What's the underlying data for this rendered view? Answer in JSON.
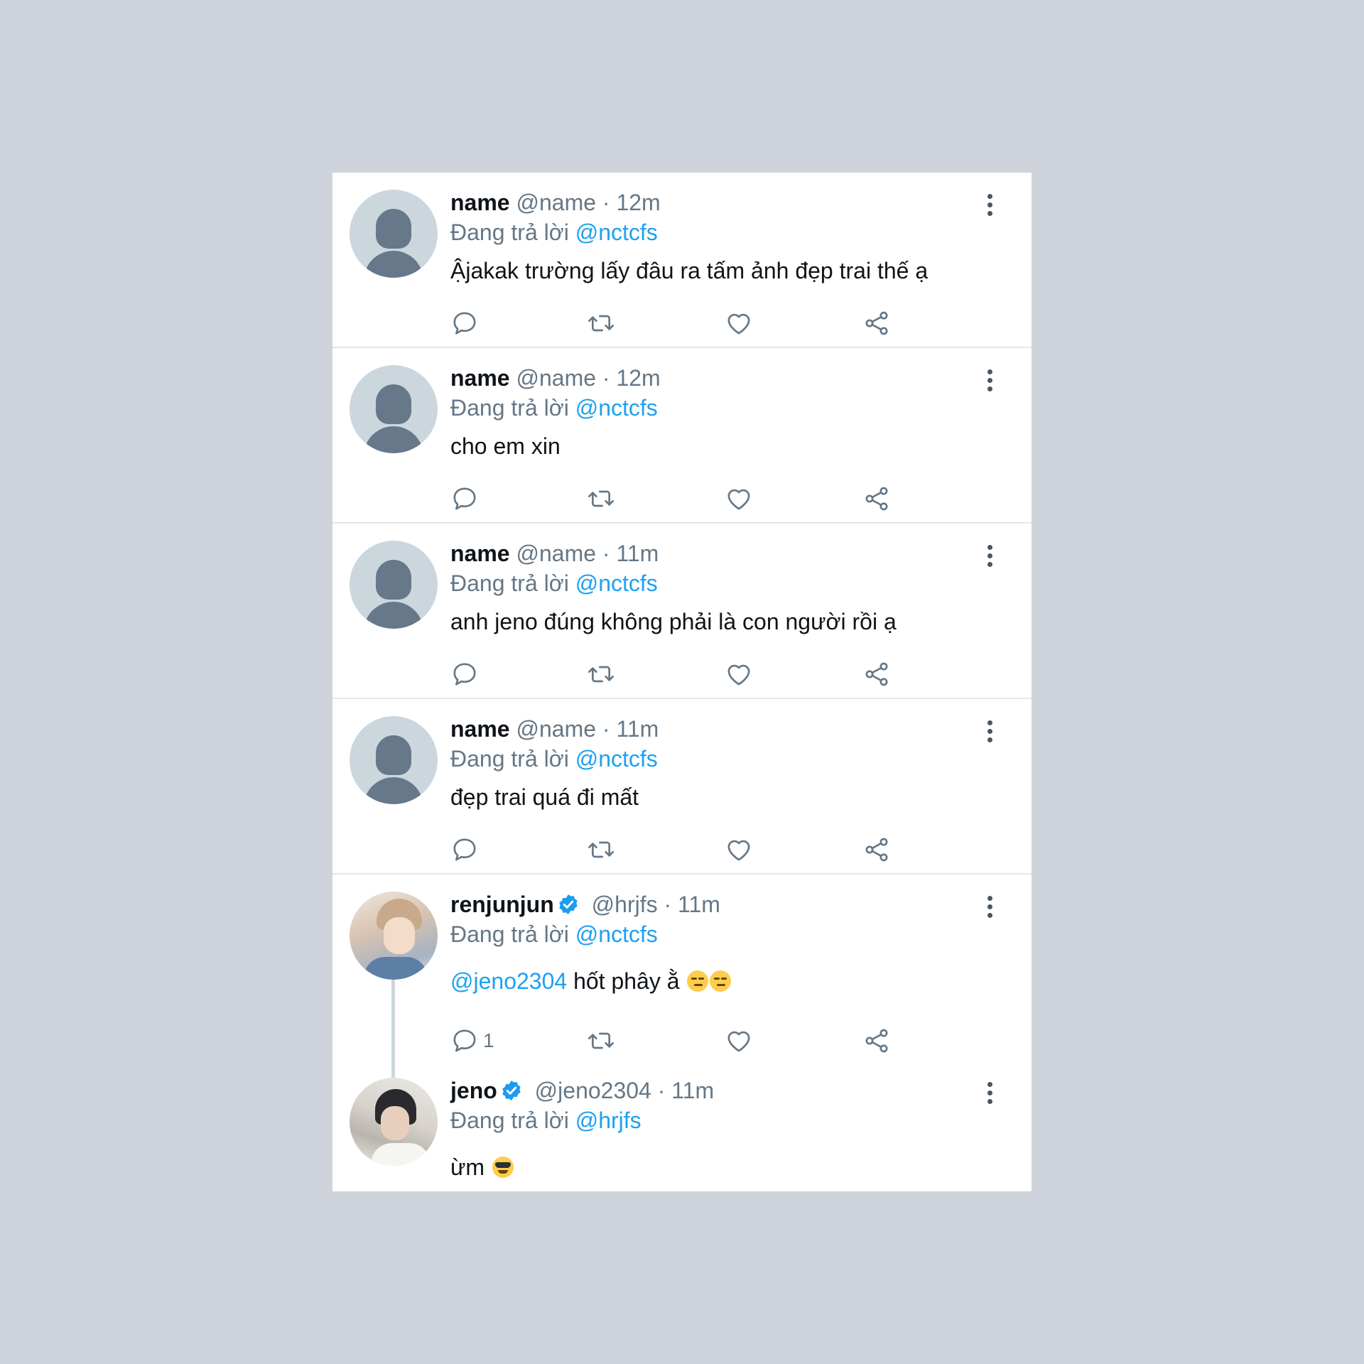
{
  "tweets": [
    {
      "name": "name",
      "handle": "@name",
      "time": "12m",
      "replying_prefix": "Đang trả lời",
      "replying_to": "@nctcfs",
      "text": "Ậjakak trường lấy đâu ra tấm ảnh đẹp trai thế ạ",
      "avatar": "default-avatar-icon"
    },
    {
      "name": "name",
      "handle": "@name",
      "time": "12m",
      "replying_prefix": "Đang trả lời",
      "replying_to": "@nctcfs",
      "text": "cho em xin",
      "avatar": "default-avatar-icon"
    },
    {
      "name": "name",
      "handle": "@name",
      "time": "11m",
      "replying_prefix": "Đang trả lời",
      "replying_to": "@nctcfs",
      "text": "anh jeno đúng không phải là con người rồi ạ",
      "avatar": "default-avatar-icon"
    },
    {
      "name": "name",
      "handle": "@name",
      "time": "11m",
      "replying_prefix": "Đang trả lời",
      "replying_to": "@nctcfs",
      "text": "đẹp trai quá đi mất",
      "avatar": "default-avatar-icon"
    },
    {
      "name": "renjunjun",
      "verified": true,
      "handle": "@hrjfs",
      "time": "11m",
      "replying_prefix": "Đang trả lời",
      "replying_to": "@nctcfs",
      "text_mention": "@jeno2304",
      "text": "hốt phây ằ",
      "reply_count": "1",
      "avatar": "profile-photo"
    },
    {
      "name": "jeno",
      "verified": true,
      "handle": "@jeno2304",
      "time": "11m",
      "replying_prefix": "Đang trả lời",
      "replying_to": "@hrjfs",
      "text": "ừm",
      "avatar": "profile-photo"
    }
  ],
  "separator": "·",
  "icons": {
    "reply": "reply-icon",
    "retweet": "retweet-icon",
    "like": "heart-icon",
    "share": "share-icon",
    "more": "more-vertical-icon",
    "verified": "verified-badge-icon"
  },
  "colors": {
    "background": "#cfd3db",
    "card": "#ffffff",
    "link": "#1da1f2",
    "secondary_text": "#657786",
    "verified": "#1d9bf0"
  }
}
